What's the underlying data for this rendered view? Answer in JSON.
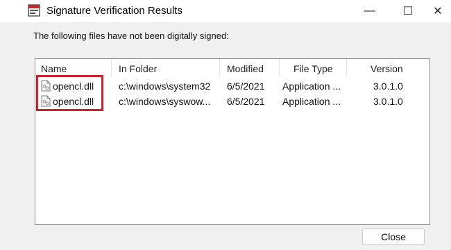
{
  "window": {
    "title": "Signature Verification Results",
    "controls": {
      "minimize": "—",
      "maximize": "☐",
      "close": "✕"
    }
  },
  "instruction": "The following files have not been digitally signed:",
  "table": {
    "columns": [
      "Name",
      "In Folder",
      "Modified",
      "File Type",
      "Version"
    ],
    "rows": [
      {
        "name": "opencl.dll",
        "folder": "c:\\windows\\system32",
        "modified": "6/5/2021",
        "type": "Application ...",
        "version": "3.0.1.0"
      },
      {
        "name": "opencl.dll",
        "folder": "c:\\windows\\syswow...",
        "modified": "6/5/2021",
        "type": "Application ...",
        "version": "3.0.1.0"
      }
    ]
  },
  "buttons": {
    "close": "Close"
  },
  "colors": {
    "highlight": "#c8242c",
    "border": "#8d8d8d"
  },
  "icons": {
    "app": "app-icon",
    "file": "dll-file-icon"
  }
}
